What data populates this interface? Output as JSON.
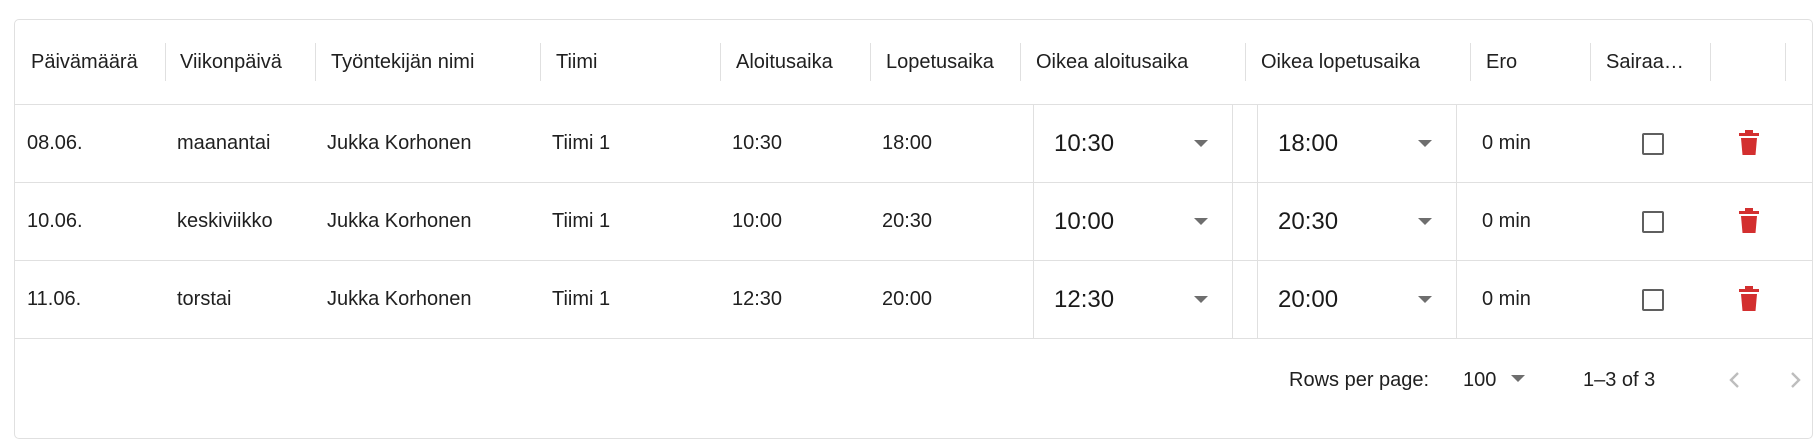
{
  "columns": [
    {
      "id": "date",
      "label": "Päivämäärä"
    },
    {
      "id": "weekday",
      "label": "Viikonpäivä"
    },
    {
      "id": "employee",
      "label": "Työntekijän nimi"
    },
    {
      "id": "team",
      "label": "Tiimi"
    },
    {
      "id": "start",
      "label": "Aloitusaika"
    },
    {
      "id": "end",
      "label": "Lopetusaika"
    },
    {
      "id": "actual_start",
      "label": "Oikea aloitusaika"
    },
    {
      "id": "actual_end",
      "label": "Oikea lopetusaika"
    },
    {
      "id": "diff",
      "label": "Ero"
    },
    {
      "id": "sick",
      "label": "Sairaa…"
    }
  ],
  "rows": [
    {
      "date": "08.06.",
      "weekday": "maanantai",
      "employee": "Jukka Korhonen",
      "team": "Tiimi 1",
      "start": "10:30",
      "end": "18:00",
      "actual_start": "10:30",
      "actual_end": "18:00",
      "diff": "0 min",
      "sick": false
    },
    {
      "date": "10.06.",
      "weekday": "keskiviikko",
      "employee": "Jukka Korhonen",
      "team": "Tiimi 1",
      "start": "10:00",
      "end": "20:30",
      "actual_start": "10:00",
      "actual_end": "20:30",
      "diff": "0 min",
      "sick": false
    },
    {
      "date": "11.06.",
      "weekday": "torstai",
      "employee": "Jukka Korhonen",
      "team": "Tiimi 1",
      "start": "12:30",
      "end": "20:00",
      "actual_start": "12:30",
      "actual_end": "20:00",
      "diff": "0 min",
      "sick": false
    }
  ],
  "footer": {
    "rows_per_page_label": "Rows per page:",
    "rows_per_page_value": "100",
    "range_text": "1–3 of 3"
  },
  "colors": {
    "delete": "#d32f2f",
    "border": "#e0e0e0",
    "icon_disabled": "#bdbdbd"
  },
  "icons": {
    "delete": "trash-icon",
    "select": "caret-down-icon",
    "prev": "chevron-left-icon",
    "next": "chevron-right-icon"
  }
}
